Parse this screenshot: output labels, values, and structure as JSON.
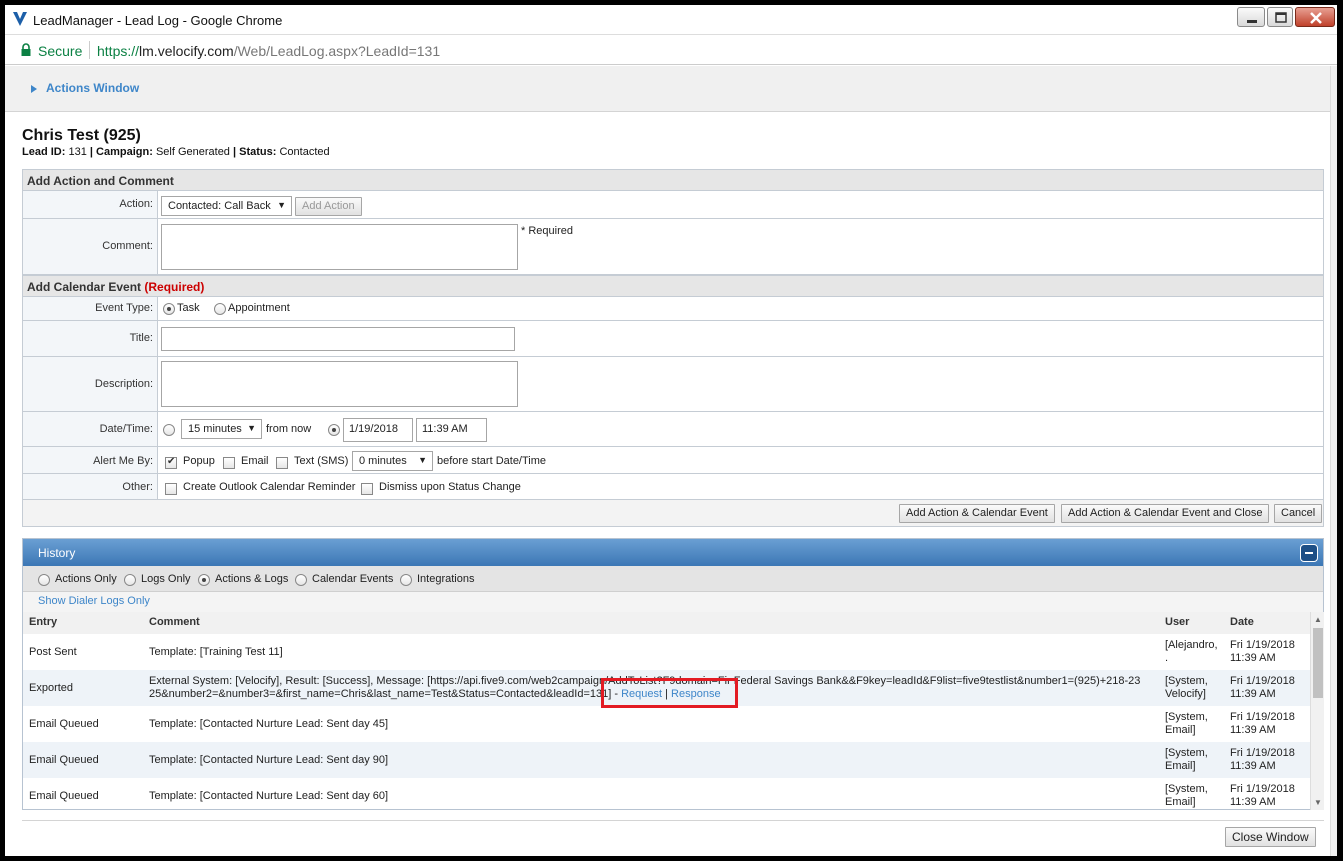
{
  "window": {
    "title": "LeadManager - Lead Log - Google Chrome"
  },
  "address_bar": {
    "secure_label": "Secure",
    "url_prefix": "https://",
    "url_host": "lm.velocify.com",
    "url_path": "/Web/LeadLog.aspx?LeadId=131"
  },
  "actions_window": {
    "label": "Actions Window"
  },
  "lead": {
    "name": "Chris Test (925)",
    "lead_id_label": "Lead ID:",
    "lead_id": "131",
    "campaign_label": "Campaign:",
    "campaign": "Self Generated",
    "status_label": "Status:",
    "status": "Contacted",
    "separator": "|"
  },
  "add_action": {
    "header": "Add Action and Comment",
    "action_label": "Action:",
    "action_value": "Contacted: Call Back",
    "add_action_button": "Add Action",
    "comment_label": "Comment:",
    "required_note": "* Required"
  },
  "calendar": {
    "header": "Add Calendar Event",
    "header_required": "(Required)",
    "event_type_label": "Event Type:",
    "event_type_options": [
      "Task",
      "Appointment"
    ],
    "event_type_selected": "Task",
    "title_label": "Title:",
    "description_label": "Description:",
    "datetime_label": "Date/Time:",
    "relative_value": "15 minutes",
    "from_now": "from now",
    "date_value": "1/19/2018",
    "time_value": "11:39 AM",
    "alert_label": "Alert Me By:",
    "alert_popup": "Popup",
    "alert_popup_checked": true,
    "alert_email": "Email",
    "alert_text": "Text (SMS)",
    "alert_offset": "0 minutes",
    "alert_suffix": "before start Date/Time",
    "other_label": "Other:",
    "other_outlook": "Create Outlook Calendar Reminder",
    "other_dismiss": "Dismiss upon Status Change"
  },
  "form_buttons": {
    "add_event": "Add Action & Calendar Event",
    "add_event_close": "Add Action & Calendar Event and Close",
    "cancel": "Cancel"
  },
  "history": {
    "title": "History",
    "filters": [
      "Actions Only",
      "Logs Only",
      "Actions & Logs",
      "Calendar Events",
      "Integrations"
    ],
    "filter_selected": "Actions & Logs",
    "dialer_link": "Show Dialer Logs Only",
    "columns": {
      "entry": "Entry",
      "comment": "Comment",
      "user": "User",
      "date": "Date"
    },
    "rows": [
      {
        "entry": "Post Sent",
        "comment": "Template: [Training Test 11]",
        "user_line1": "[Alejandro,",
        "user_line2": ".",
        "date_line1": "Fri 1/19/2018",
        "date_line2": "11:39 AM"
      },
      {
        "entry": "Exported",
        "comment_line1": "External System: [Velocify], Result: [Success], Message: [https://api.five9.com/web2campaign/AddToList?F9domain=Fir  Federal Savings Bank&&F9key=leadId&F9list=five9testlist&number1=(925)+218-23",
        "comment_line2": "25&number2=&number3=&first_name=Chris&last_name=Test&Status=Contacted&leadId=131] -",
        "request_link": "Request",
        "link_sep": "|",
        "response_link": "Response",
        "user_line1": "[System,",
        "user_line2": "Velocify]",
        "date_line1": "Fri 1/19/2018",
        "date_line2": "11:39 AM"
      },
      {
        "entry": "Email Queued",
        "comment": "Template: [Contacted Nurture Lead: Sent day 45]",
        "user_line1": "[System,",
        "user_line2": "Email]",
        "date_line1": "Fri 1/19/2018",
        "date_line2": "11:39 AM"
      },
      {
        "entry": "Email Queued",
        "comment": "Template: [Contacted Nurture Lead: Sent day 90]",
        "user_line1": "[System,",
        "user_line2": "Email]",
        "date_line1": "Fri 1/19/2018",
        "date_line2": "11:39 AM"
      },
      {
        "entry": "Email Queued",
        "comment": "Template: [Contacted Nurture Lead: Sent day 60]",
        "user_line1": "[System,",
        "user_line2": "Email]",
        "date_line1": "Fri 1/19/2018",
        "date_line2": "11:39 AM"
      }
    ]
  },
  "footer": {
    "close_button": "Close Window"
  },
  "colors": {
    "accent_blue": "#3e86c9",
    "history_header": "#4a86c4",
    "required_red": "#cc0000",
    "highlight_box": "#e31b23",
    "secure_green": "#0b8043"
  }
}
